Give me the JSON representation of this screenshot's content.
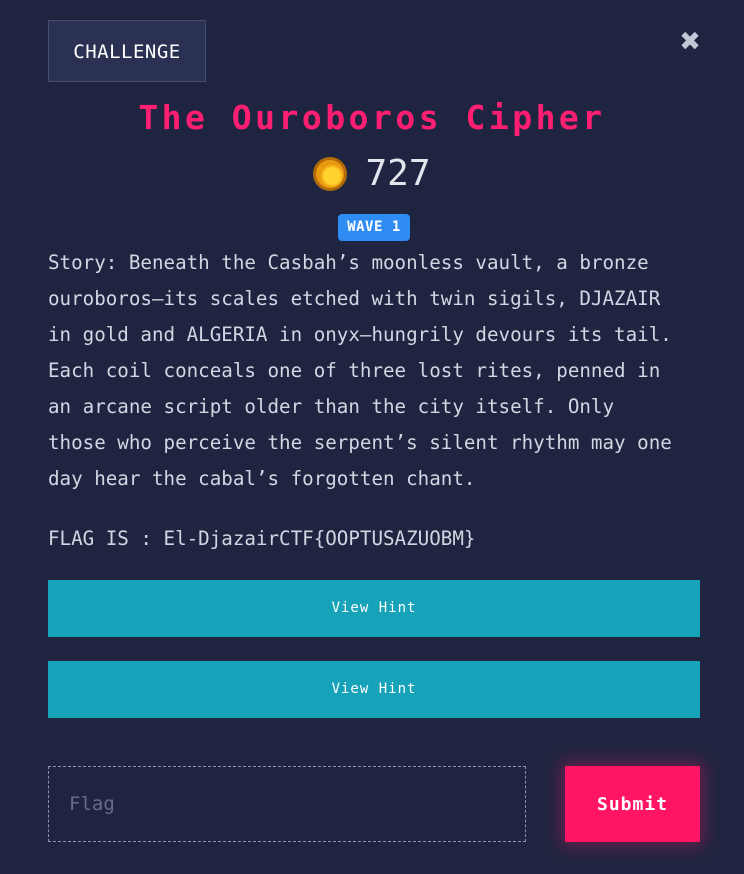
{
  "tab": {
    "label": "CHALLENGE"
  },
  "close": {
    "icon": "close-icon",
    "glyph": "✖"
  },
  "challenge": {
    "title": "The Ouroboros Cipher",
    "points": "727",
    "points_icon": "coin-icon",
    "badge": "WAVE 1",
    "story": "Story: Beneath the Casbah’s moonless vault, a bronze\nouroboros—its scales etched with twin sigils, DJAZAIR\nin gold and ALGERIA in onyx—hungrily devours its tail.\nEach coil conceals one of three lost rites, penned in\nan arcane script older than the city itself. Only\nthose who perceive the serpent’s silent rhythm may one\nday hear the cabal’s forgotten chant.",
    "flag_line": "FLAG IS : El-DjazairCTF{OOPTUSAZUOBM}"
  },
  "hints": [
    {
      "label": "View Hint"
    },
    {
      "label": "View Hint"
    }
  ],
  "form": {
    "placeholder": "Flag",
    "value": "",
    "submit_label": "Submit"
  },
  "colors": {
    "background": "#1f2540",
    "title": "#ff1f72",
    "hint_button": "#16a2b8",
    "submit_button": "#ff1466",
    "badge": "#2f8cf2"
  }
}
